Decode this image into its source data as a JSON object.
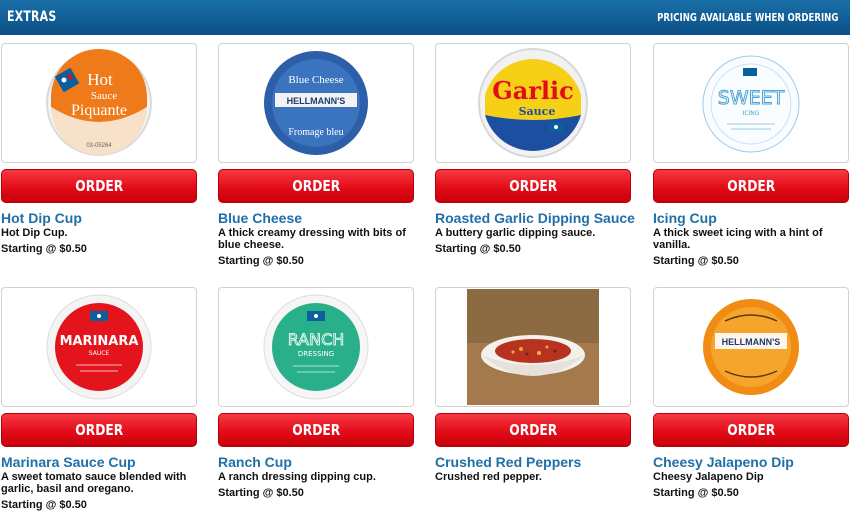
{
  "header": {
    "title": "EXTRAS",
    "pricing_note": "PRICING AVAILABLE WHEN ORDERING"
  },
  "order_label": "ORDER",
  "items": [
    {
      "name": "Hot Dip Cup",
      "description": "Hot Dip Cup.",
      "price": "Starting @ $0.50",
      "image": "hot-sauce-cup",
      "label": [
        "Hot",
        "Sauce",
        "Piquante"
      ],
      "fine_print": "03-05264"
    },
    {
      "name": "Blue Cheese",
      "description": "A thick creamy dressing with bits of blue cheese.",
      "price": "Starting @ $0.50",
      "image": "blue-cheese-cup",
      "label": [
        "Blue Cheese",
        "HELLMANN'S",
        "Fromage bleu"
      ]
    },
    {
      "name": "Roasted Garlic Dipping Sauce",
      "description": "A buttery garlic dipping sauce.",
      "price": "Starting @ $0.50",
      "image": "garlic-sauce-cup",
      "label": [
        "Garlic",
        "Sauce"
      ]
    },
    {
      "name": "Icing Cup",
      "description": "A thick sweet icing with a hint of vanilla.",
      "price": "Starting @ $0.50",
      "image": "icing-cup",
      "label": [
        "SWEET",
        "ICING"
      ]
    },
    {
      "name": "Marinara Sauce Cup",
      "description": "A sweet tomato sauce blended with garlic, basil and oregano.",
      "price": "Starting @ $0.50",
      "image": "marinara-cup",
      "label": [
        "MARINARA",
        "SAUCE"
      ]
    },
    {
      "name": "Ranch Cup",
      "description": "A ranch dressing dipping cup.",
      "price": "Starting @ $0.50",
      "image": "ranch-cup",
      "label": [
        "RANCH",
        "DRESSING"
      ]
    },
    {
      "name": "Crushed Red Peppers",
      "description": "Crushed red pepper.",
      "price": "",
      "image": "red-pepper-bowl"
    },
    {
      "name": "Cheesy Jalapeno Dip",
      "description": "Cheesy Jalapeno Dip",
      "price": "Starting @ $0.50",
      "image": "jalapeno-cup",
      "label": [
        "HELLMANN'S"
      ]
    }
  ],
  "colors": {
    "header": "#0b5f9c",
    "order": "#e30c19",
    "name": "#1f6fa8"
  }
}
